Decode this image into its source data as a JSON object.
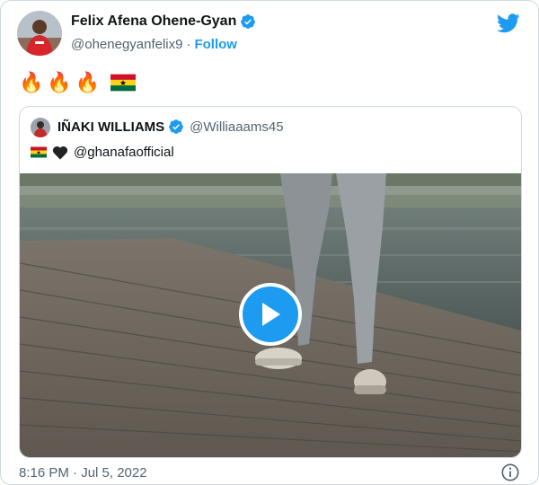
{
  "author": {
    "name": "Felix Afena Ohene-Gyan",
    "handle": "@ohenegyanfelix9",
    "separator": "·",
    "follow_label": "Follow"
  },
  "tweet": {
    "emoji_fire": "🔥",
    "fire_count": 3,
    "flag": "ghana-flag"
  },
  "quoted": {
    "name": "IÑAKI WILLIAMS",
    "handle": "@Williaaams45",
    "mention": "@ghanafaofficial"
  },
  "media": {
    "type": "video",
    "play_icon": "play-icon"
  },
  "footer": {
    "timestamp": "8:16 PM · Jul 5, 2022",
    "info_icon": "info-icon"
  },
  "colors": {
    "accent": "#1d9bf0",
    "text": "#0f1419",
    "secondary": "#536471",
    "border": "#cfd9de"
  }
}
